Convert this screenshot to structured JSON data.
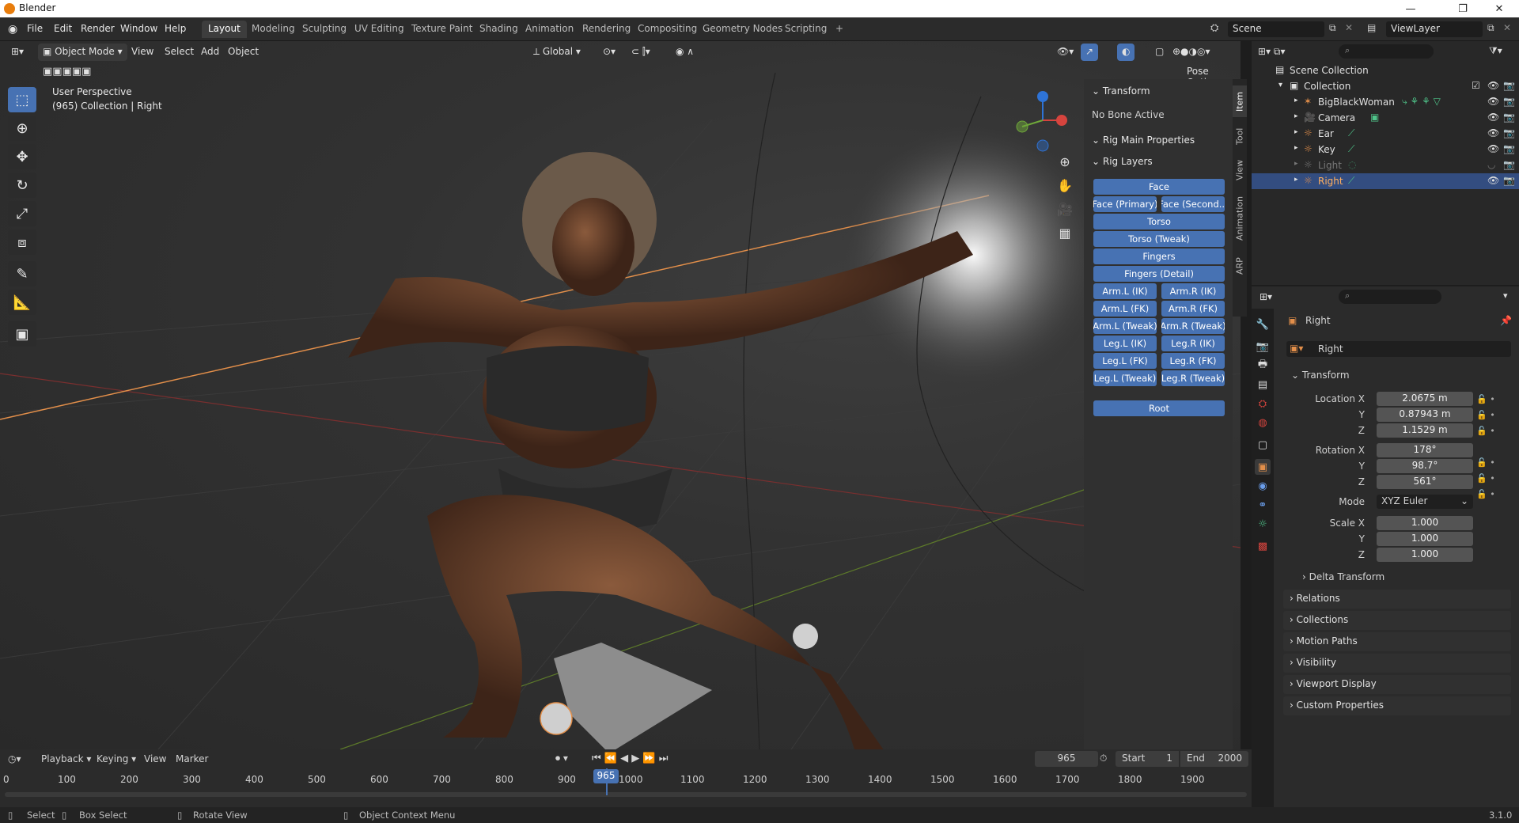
{
  "app": {
    "title": "Blender",
    "version": "3.1.0"
  },
  "menu": [
    "File",
    "Edit",
    "Render",
    "Window",
    "Help"
  ],
  "workspaces": [
    "Layout",
    "Modeling",
    "Sculpting",
    "UV Editing",
    "Texture Paint",
    "Shading",
    "Animation",
    "Rendering",
    "Compositing",
    "Geometry Nodes",
    "Scripting",
    "+"
  ],
  "active_workspace": "Layout",
  "scene": {
    "name": "Scene",
    "view_layer": "ViewLayer"
  },
  "viewport_header": {
    "mode": "Object Mode",
    "menus": [
      "View",
      "Select",
      "Add",
      "Object"
    ],
    "orientation": "Global",
    "pose_options": "Pose Options"
  },
  "viewport": {
    "perspective": "User Perspective",
    "info": "(965) Collection | Right"
  },
  "npanel": {
    "tabs": [
      "Item",
      "Tool",
      "View",
      "Animation",
      "ARP"
    ],
    "transform_title": "Transform",
    "no_bone": "No Bone Active",
    "rig_main": "Rig Main Properties",
    "rig_layers": "Rig Layers",
    "layers_full": [
      "Face"
    ],
    "layers_pairs": [
      [
        "Face (Primary)",
        "Face (Second..."
      ]
    ],
    "layers_full2": [
      "Torso",
      "Torso (Tweak)",
      "Fingers",
      "Fingers (Detail)"
    ],
    "limbs": [
      [
        "Arm.L (IK)",
        "Arm.R (IK)"
      ],
      [
        "Arm.L (FK)",
        "Arm.R (FK)"
      ],
      [
        "Arm.L (Tweak)",
        "Arm.R (Tweak)"
      ],
      [
        "Leg.L (IK)",
        "Leg.R (IK)"
      ],
      [
        "Leg.L (FK)",
        "Leg.R (FK)"
      ],
      [
        "Leg.L (Tweak)",
        "Leg.R (Tweak)"
      ]
    ],
    "root": "Root"
  },
  "outliner": {
    "root": "Scene Collection",
    "collection": "Collection",
    "items": [
      {
        "name": "BigBlackWoman",
        "color": "#e38f4a"
      },
      {
        "name": "Camera",
        "color": "#e38f4a"
      },
      {
        "name": "Ear",
        "color": "#e38f4a"
      },
      {
        "name": "Key",
        "color": "#e38f4a"
      },
      {
        "name": "Light",
        "color": "#8a8a8a"
      },
      {
        "name": "Right",
        "color": "#e38f4a"
      }
    ],
    "selected": "Right"
  },
  "properties": {
    "object_name": "Right",
    "data_name": "Right",
    "transform": "Transform",
    "location": {
      "label": "Location X",
      "x": "2.0675 m",
      "y": "0.87943 m",
      "z": "1.1529 m"
    },
    "rotation": {
      "label": "Rotation X",
      "x": "178°",
      "y": "98.7°",
      "z": "561°"
    },
    "mode_label": "Mode",
    "mode": "XYZ Euler",
    "scale": {
      "label": "Scale X",
      "x": "1.000",
      "y": "1.000",
      "z": "1.000"
    },
    "axis_y": "Y",
    "axis_z": "Z",
    "delta": "Delta Transform",
    "sections": [
      "Relations",
      "Collections",
      "Motion Paths",
      "Visibility",
      "Viewport Display",
      "Custom Properties"
    ]
  },
  "timeline": {
    "menus": [
      "Playback",
      "Keying",
      "View",
      "Marker"
    ],
    "current_frame": "965",
    "start_label": "Start",
    "start": "1",
    "end_label": "End",
    "end": "2000",
    "ticks": [
      "0",
      "100",
      "200",
      "300",
      "400",
      "500",
      "600",
      "700",
      "800",
      "900",
      "1000",
      "1100",
      "1200",
      "1300",
      "1400",
      "1500",
      "1600",
      "1700",
      "1800",
      "1900"
    ]
  },
  "status": {
    "select": "Select",
    "box_select": "Box Select",
    "rotate": "Rotate View",
    "context": "Object Context Menu",
    "version": "3.1.0"
  },
  "colors": {
    "accent": "#4772b3",
    "selection": "#334d80",
    "orange_axis": "#e38f4a"
  }
}
